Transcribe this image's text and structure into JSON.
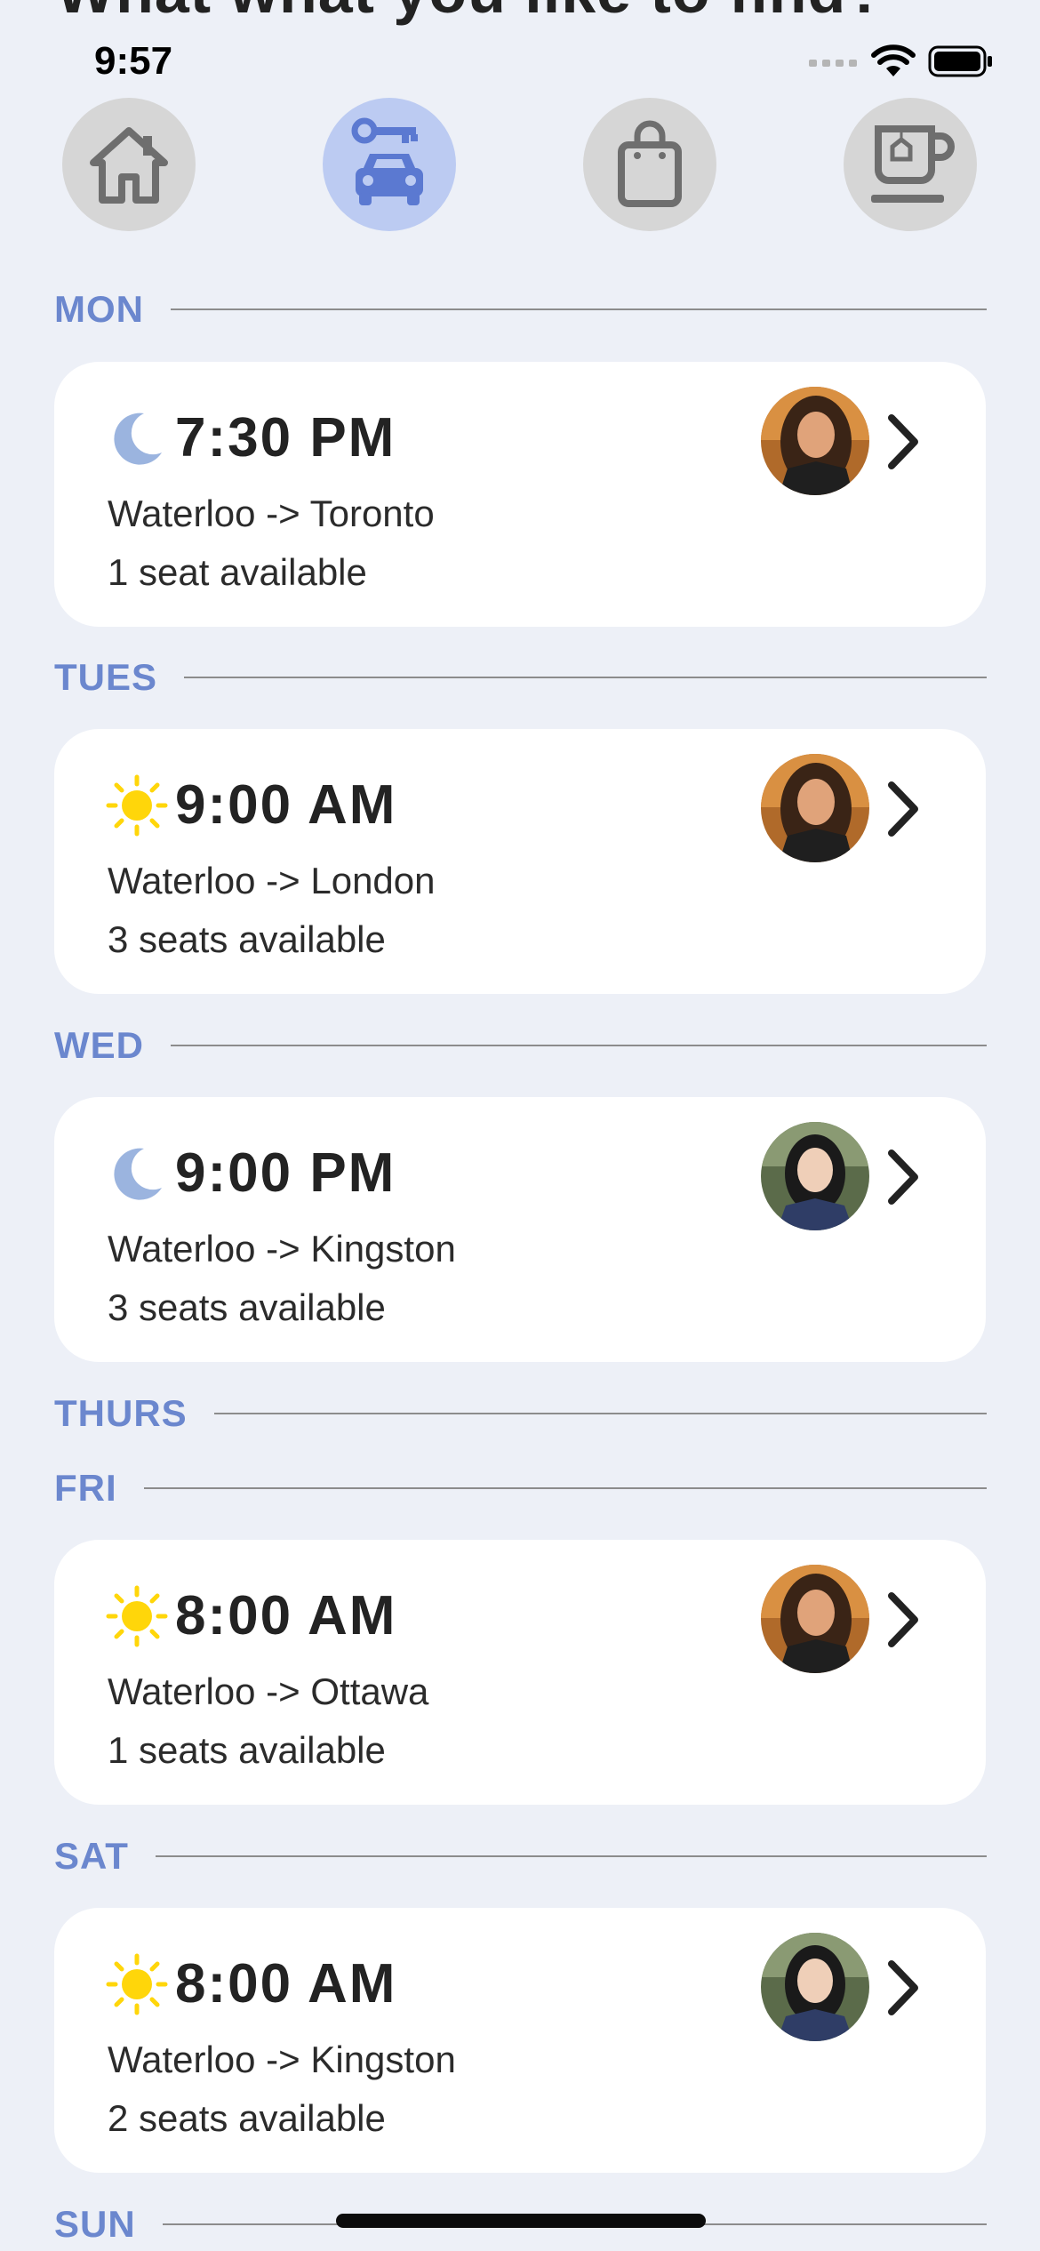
{
  "page": {
    "heading": "What what you like to find?"
  },
  "status_bar": {
    "time": "9:57"
  },
  "categories": [
    {
      "name": "home",
      "icon": "house-icon",
      "active": false
    },
    {
      "name": "car",
      "icon": "car-key-icon",
      "active": true
    },
    {
      "name": "shopping",
      "icon": "shopping-bag-icon",
      "active": false
    },
    {
      "name": "cafe",
      "icon": "coffee-cup-icon",
      "active": false
    }
  ],
  "days": {
    "mon": "MON",
    "tues": "TUES",
    "wed": "WED",
    "thurs": "THURS",
    "fri": "FRI",
    "sat": "SAT",
    "sun": "SUN"
  },
  "rides": [
    {
      "time": "7:30 PM",
      "route": "Waterloo -> Toronto",
      "seats": "1 seat available",
      "icon": "moon-icon",
      "driver": "driver-a"
    },
    {
      "time": "9:00 AM",
      "route": "Waterloo -> London",
      "seats": "3 seats available",
      "icon": "sun-icon",
      "driver": "driver-a"
    },
    {
      "time": "9:00 PM",
      "route": "Waterloo -> Kingston",
      "seats": "3 seats available",
      "icon": "moon-icon",
      "driver": "driver-b"
    },
    {
      "time": "8:00 AM",
      "route": "Waterloo -> Ottawa",
      "seats": "1 seats available",
      "icon": "sun-icon",
      "driver": "driver-a"
    },
    {
      "time": "8:00 AM",
      "route": "Waterloo -> Kingston",
      "seats": "2 seats available",
      "icon": "sun-icon",
      "driver": "driver-b"
    }
  ],
  "colors": {
    "background": "#edf0f7",
    "accent": "#6b87ce",
    "active_category": "#bccbf2",
    "inactive_category": "#d6d6d6",
    "sun": "#ffd60a",
    "moon": "#9bb4df"
  }
}
